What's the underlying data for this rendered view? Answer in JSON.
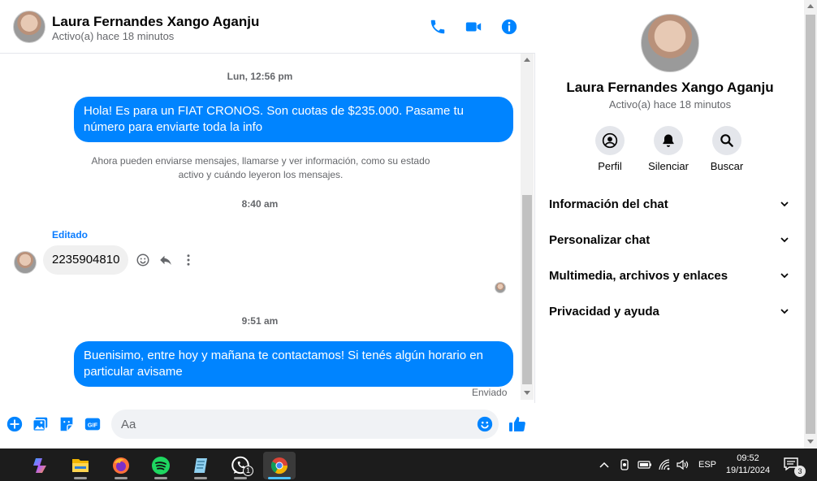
{
  "contact": {
    "name": "Laura Fernandes Xango Aganju",
    "status": "Activo(a) hace 18 minutos"
  },
  "header": {
    "call_icon": "phone-icon",
    "video_icon": "video-camera-icon",
    "info_icon": "info-icon"
  },
  "messages": {
    "timestamp_1": "Lun, 12:56 pm",
    "outgoing_1": "Hola! Es para un FIAT CRONOS. Son cuotas de $235.000. Pasame tu número para enviarte toda la info",
    "system_notice": "Ahora pueden enviarse mensajes, llamarse y ver información, como su estado activo y cuándo leyeron los mensajes.",
    "timestamp_2": "8:40 am",
    "edited_label": "Editado",
    "incoming_1": "2235904810",
    "timestamp_3": "9:51 am",
    "outgoing_2": "Buenisimo, entre hoy y mañana te contactamos! Si tenés algún horario en particular avisame",
    "sent_status": "Enviado"
  },
  "composer": {
    "placeholder": "Aa"
  },
  "info_panel": {
    "actions": [
      {
        "label": "Perfil",
        "icon": "profile-icon"
      },
      {
        "label": "Silenciar",
        "icon": "bell-icon"
      },
      {
        "label": "Buscar",
        "icon": "search-icon"
      }
    ],
    "sections": [
      "Información del chat",
      "Personalizar chat",
      "Multimedia, archivos y enlaces",
      "Privacidad y ayuda"
    ]
  },
  "taskbar": {
    "whatsapp_badge": "1",
    "language": "ESP",
    "time": "09:52",
    "date": "19/11/2024",
    "notification_count": "3"
  },
  "colors": {
    "messenger_blue": "#0084ff",
    "bubble_gray": "#f0f0f0",
    "taskbar": "#1c1c1c"
  }
}
